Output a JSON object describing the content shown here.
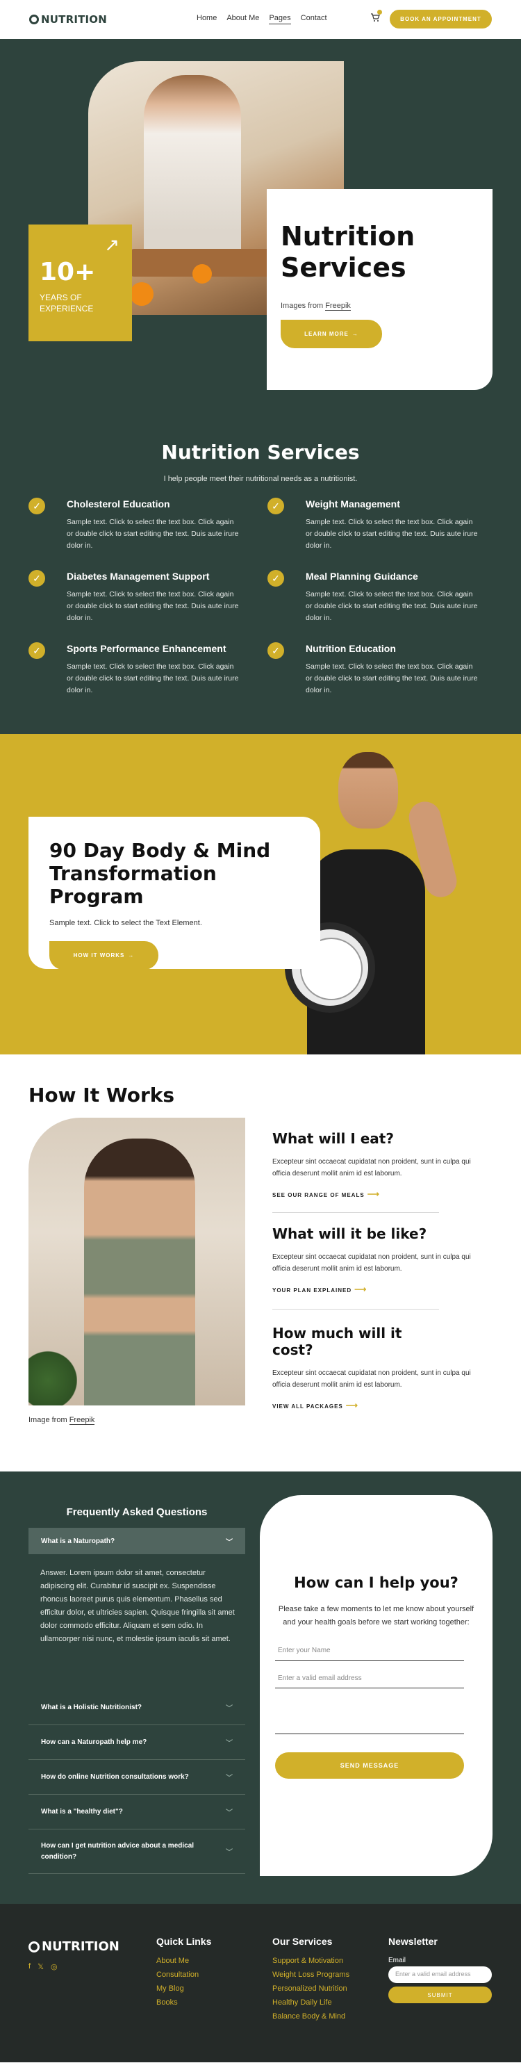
{
  "header": {
    "brand": "NUTRITION",
    "nav": [
      "Home",
      "About Me",
      "Pages",
      "Contact"
    ],
    "active_nav": "Pages",
    "cta": "BOOK AN APPOINTMENT"
  },
  "hero": {
    "badge_number": "10+",
    "badge_label": "YEARS OF EXPERIENCE",
    "title": "Nutrition Services",
    "credit_prefix": "Images from",
    "credit_link": "Freepik",
    "button": "LEARN MORE"
  },
  "services": {
    "title": "Nutrition Services",
    "subtitle": "I help people meet their nutritional needs as a nutritionist.",
    "items": [
      {
        "title": "Cholesterol Education",
        "text": "Sample text. Click to select the text box. Click again or double click to start editing the text. Duis aute irure dolor in."
      },
      {
        "title": "Weight Management",
        "text": "Sample text. Click to select the text box. Click again or double click to start editing the text. Duis aute irure dolor in."
      },
      {
        "title": "Diabetes Management Support",
        "text": "Sample text. Click to select the text box. Click again or double click to start editing the text. Duis aute irure dolor in."
      },
      {
        "title": "Meal Planning Guidance",
        "text": "Sample text. Click to select the text box. Click again or double click to start editing the text. Duis aute irure dolor in."
      },
      {
        "title": "Sports Performance Enhancement",
        "text": "Sample text. Click to select the text box. Click again or double click to start editing the text. Duis aute irure dolor in."
      },
      {
        "title": "Nutrition Education",
        "text": "Sample text. Click to select the text box. Click again or double click to start editing the text. Duis aute irure dolor in."
      }
    ]
  },
  "program": {
    "title": "90 Day Body & Mind Transformation Program",
    "text": "Sample text. Click to select the Text Element.",
    "button": "HOW IT WORKS"
  },
  "how": {
    "title": "How It Works",
    "credit_prefix": "Image from",
    "credit_link": "Freepik",
    "items": [
      {
        "q": "What will I eat?",
        "a": "Excepteur sint occaecat cupidatat non proident, sunt in culpa qui officia deserunt mollit anim id est laborum.",
        "link": "SEE OUR RANGE OF MEALS"
      },
      {
        "q": "What will it be like?",
        "a": "Excepteur sint occaecat cupidatat non proident, sunt in culpa qui officia deserunt mollit anim id est laborum.",
        "link": "YOUR PLAN EXPLAINED"
      },
      {
        "q": "How much will it cost?",
        "a": "Excepteur sint occaecat cupidatat non proident, sunt in culpa qui officia deserunt mollit anim id est laborum.",
        "link": "VIEW ALL PACKAGES"
      }
    ]
  },
  "faq": {
    "title": "Frequently Asked Questions",
    "open_question": "What is a Naturopath?",
    "open_answer": "Answer. Lorem ipsum dolor sit amet, consectetur adipiscing elit. Curabitur id suscipit ex. Suspendisse rhoncus laoreet purus quis elementum. Phasellus sed efficitur dolor, et ultricies sapien. Quisque fringilla sit amet dolor commodo efficitur. Aliquam et sem odio. In ullamcorper nisi nunc, et molestie ipsum iaculis sit amet.",
    "questions": [
      "What is a Holistic Nutritionist?",
      "How can a Naturopath help me?",
      "How do online Nutrition consultations work?",
      "What is a \"healthy diet\"?",
      "How can I get nutrition advice about a medical condition?"
    ]
  },
  "contact": {
    "title": "How can I help you?",
    "intro": "Please take a few moments to let me know about yourself and your health goals before we start working together:",
    "name_placeholder": "Enter your Name",
    "email_placeholder": "Enter a valid email address",
    "button": "SEND MESSAGE"
  },
  "footer": {
    "brand": "NUTRITION",
    "quick_links_title": "Quick Links",
    "quick_links": [
      "About Me",
      "Consultation",
      "My Blog",
      "Books"
    ],
    "services_title": "Our Services",
    "services": [
      "Support & Motivation",
      "Weight Loss Programs",
      "Personalized Nutrition",
      "Healthy Daily Life",
      "Balance Body & Mind"
    ],
    "newsletter_title": "Newsletter",
    "newsletter_label": "Email",
    "newsletter_placeholder": "Enter a valid email address",
    "newsletter_button": "SUBMIT"
  },
  "colors": {
    "dark_green": "#2e433d",
    "gold": "#d1b02a",
    "footer": "#252a28"
  },
  "icons": [
    "cart-icon",
    "arrow-up-right-icon",
    "check-icon",
    "arrow-right-icon",
    "chevron-down-icon",
    "facebook-icon",
    "x-icon",
    "instagram-icon"
  ]
}
